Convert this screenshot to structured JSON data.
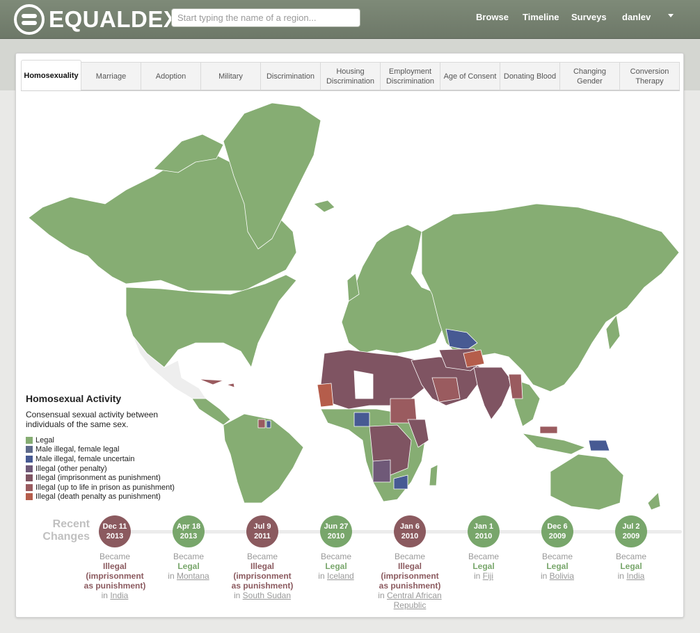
{
  "brand": {
    "name": "EQUALDEX"
  },
  "search": {
    "placeholder": "Start typing the name of a region..."
  },
  "nav": {
    "browse": "Browse",
    "timeline": "Timeline",
    "surveys": "Surveys",
    "user": "danlev"
  },
  "tabs": [
    {
      "label": "Homosexuality",
      "active": true
    },
    {
      "label": "Marriage"
    },
    {
      "label": "Adoption"
    },
    {
      "label": "Military"
    },
    {
      "label": "Discrimination"
    },
    {
      "label": "Housing Discrimination"
    },
    {
      "label": "Employment Discrimination"
    },
    {
      "label": "Age of Consent"
    },
    {
      "label": "Donating Blood"
    },
    {
      "label": "Changing Gender"
    },
    {
      "label": "Conversion Therapy"
    }
  ],
  "legend": {
    "title": "Homosexual Activity",
    "description": "Consensual sexual activity between individuals of the same sex.",
    "items": [
      {
        "label": "Legal",
        "color": "#86ad73"
      },
      {
        "label": "Male illegal, female legal",
        "color": "#5e6a8b"
      },
      {
        "label": "Male illegal, female uncertain",
        "color": "#475a93"
      },
      {
        "label": "Illegal (other penalty)",
        "color": "#6f5978"
      },
      {
        "label": "Illegal (imprisonment as punishment)",
        "color": "#7f5462"
      },
      {
        "label": "Illegal (up to life in prison as punishment)",
        "color": "#9a5b5f"
      },
      {
        "label": "Illegal (death penalty as punishment)",
        "color": "#b55d4b"
      }
    ]
  },
  "colors": {
    "legal": "#86ad73",
    "illegal": "#8b5a5f",
    "map_uncertain": "#eeeeee"
  },
  "recent": {
    "title": "Recent Changes",
    "became": "Became",
    "in": "in",
    "items": [
      {
        "month": "Dec 11",
        "year": "2013",
        "status": "Illegal (imprisonment as punishment)",
        "status_lines": [
          "Illegal",
          "(imprisonment",
          "as punishment)"
        ],
        "kind": "illegal",
        "region": "India"
      },
      {
        "month": "Apr 18",
        "year": "2013",
        "status": "Legal",
        "status_lines": [
          "Legal"
        ],
        "kind": "legal",
        "region": "Montana"
      },
      {
        "month": "Jul 9",
        "year": "2011",
        "status": "Illegal (imprisonment as punishment)",
        "status_lines": [
          "Illegal",
          "(imprisonment",
          "as punishment)"
        ],
        "kind": "illegal",
        "region": "South Sudan"
      },
      {
        "month": "Jun 27",
        "year": "2010",
        "status": "Legal",
        "status_lines": [
          "Legal"
        ],
        "kind": "legal",
        "region": "Iceland"
      },
      {
        "month": "Jan 6",
        "year": "2010",
        "status": "Illegal (imprisonment as punishment)",
        "status_lines": [
          "Illegal",
          "(imprisonment",
          "as punishment)"
        ],
        "kind": "illegal",
        "region": "Central African Republic"
      },
      {
        "month": "Jan 1",
        "year": "2010",
        "status": "Legal",
        "status_lines": [
          "Legal"
        ],
        "kind": "legal",
        "region": "Fiji"
      },
      {
        "month": "Dec 6",
        "year": "2009",
        "status": "Legal",
        "status_lines": [
          "Legal"
        ],
        "kind": "legal",
        "region": "Bolivia"
      },
      {
        "month": "Jul 2",
        "year": "2009",
        "status": "Legal",
        "status_lines": [
          "Legal"
        ],
        "kind": "legal",
        "region": "India"
      }
    ]
  }
}
